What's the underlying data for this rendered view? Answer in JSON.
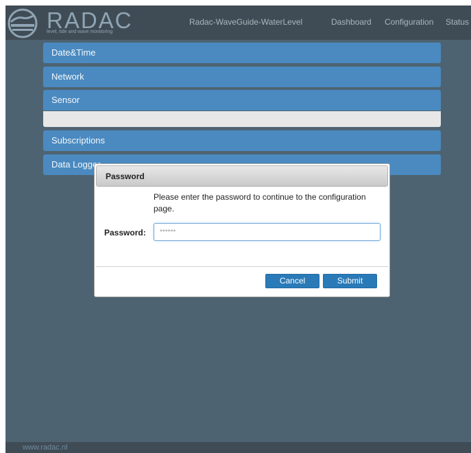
{
  "navbar": {
    "brand": "RADAC",
    "tagline": "level, tide and wave monitoring",
    "title": "Radac-WaveGuide-WaterLevel",
    "links": [
      "Dashboard",
      "Configuration",
      "Status"
    ]
  },
  "panels": [
    {
      "label": "Date&Time"
    },
    {
      "label": "Network"
    },
    {
      "label": "Sensor"
    },
    {
      "label": "Subscriptions"
    },
    {
      "label": "Data Logger"
    }
  ],
  "modal": {
    "title": "Password",
    "message": "Please enter the password to continue to the configuration page.",
    "password_label": "Password:",
    "password_placeholder": "******",
    "cancel_label": "Cancel",
    "submit_label": "Submit"
  },
  "footer": {
    "link": "www.radac.nl"
  },
  "colors": {
    "panel_header": "#4a8ac0",
    "navbar_bg": "#404c55",
    "page_bg": "#4e6371",
    "button": "#2a7ab8"
  }
}
